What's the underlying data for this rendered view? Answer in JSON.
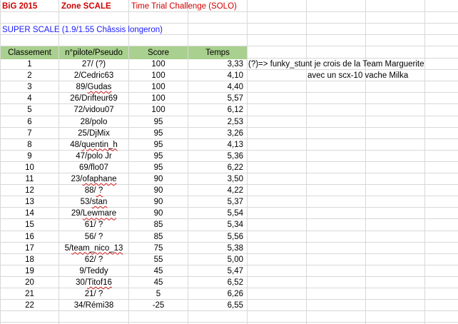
{
  "title_row": {
    "event": "BiG 2015",
    "zone": "Zone SCALE",
    "challenge": "Time Trial Challenge (SOLO)"
  },
  "category": "SUPER SCALE (1.9/1.55 Châssis longeron)",
  "headers": {
    "rank": "Classement",
    "pilot": "n°pilote/Pseudo",
    "score": "Score",
    "time": "Temps"
  },
  "note": {
    "line1": "(?)=> funky_stunt je crois de la Team Marguerite",
    "line2": "avec un scx-10 vache Milka"
  },
  "rows": [
    {
      "rank": "1",
      "pilot": "27/ (?)",
      "score": "100",
      "time": "3,33"
    },
    {
      "rank": "2",
      "pilot": "2/Cedric63",
      "score": "100",
      "time": "4,10"
    },
    {
      "rank": "3",
      "pilot": "89/Gudas",
      "score": "100",
      "time": "4,40"
    },
    {
      "rank": "4",
      "pilot": "26/Drifteur69",
      "score": "100",
      "time": "5,57"
    },
    {
      "rank": "5",
      "pilot": "72/vidou07",
      "score": "100",
      "time": "6,12"
    },
    {
      "rank": "6",
      "pilot": "28/polo",
      "score": "95",
      "time": "2,53"
    },
    {
      "rank": "7",
      "pilot": "25/DjMix",
      "score": "95",
      "time": "3,26"
    },
    {
      "rank": "8",
      "pilot": "48/quentin_h",
      "score": "95",
      "time": "4,13"
    },
    {
      "rank": "9",
      "pilot": "47/polo Jr",
      "score": "95",
      "time": "5,36"
    },
    {
      "rank": "10",
      "pilot": "69/flo07",
      "score": "95",
      "time": "6,22"
    },
    {
      "rank": "11",
      "pilot": "23/ofaphane",
      "score": "90",
      "time": "3,50"
    },
    {
      "rank": "12",
      "pilot": "88/ ?",
      "score": "90",
      "time": "4,22"
    },
    {
      "rank": "13",
      "pilot": "53/stan",
      "score": "90",
      "time": "5,37"
    },
    {
      "rank": "14",
      "pilot": "29/Lewmare",
      "score": "90",
      "time": "5,54"
    },
    {
      "rank": "15",
      "pilot": "61/ ?",
      "score": "85",
      "time": "5,34"
    },
    {
      "rank": "16",
      "pilot": "56/ ?",
      "score": "85",
      "time": "5,56"
    },
    {
      "rank": "17",
      "pilot": "5/team_nico_13",
      "score": "75",
      "time": "5,38"
    },
    {
      "rank": "18",
      "pilot": "62/ ?",
      "score": "55",
      "time": "5,00"
    },
    {
      "rank": "19",
      "pilot": "9/Teddy",
      "score": "45",
      "time": "5,47"
    },
    {
      "rank": "20",
      "pilot": "30/Titof16",
      "score": "45",
      "time": "6,52"
    },
    {
      "rank": "21",
      "pilot": "21/ ?",
      "score": "5",
      "time": "6,26"
    },
    {
      "rank": "22",
      "pilot": "34/Rémi38",
      "score": "-25",
      "time": "6,55"
    }
  ],
  "colors": {
    "header_fill": "#a9d08e",
    "title_red": "#cc0000",
    "category_blue": "#1a1aff",
    "grid": "#d8d8d8"
  }
}
